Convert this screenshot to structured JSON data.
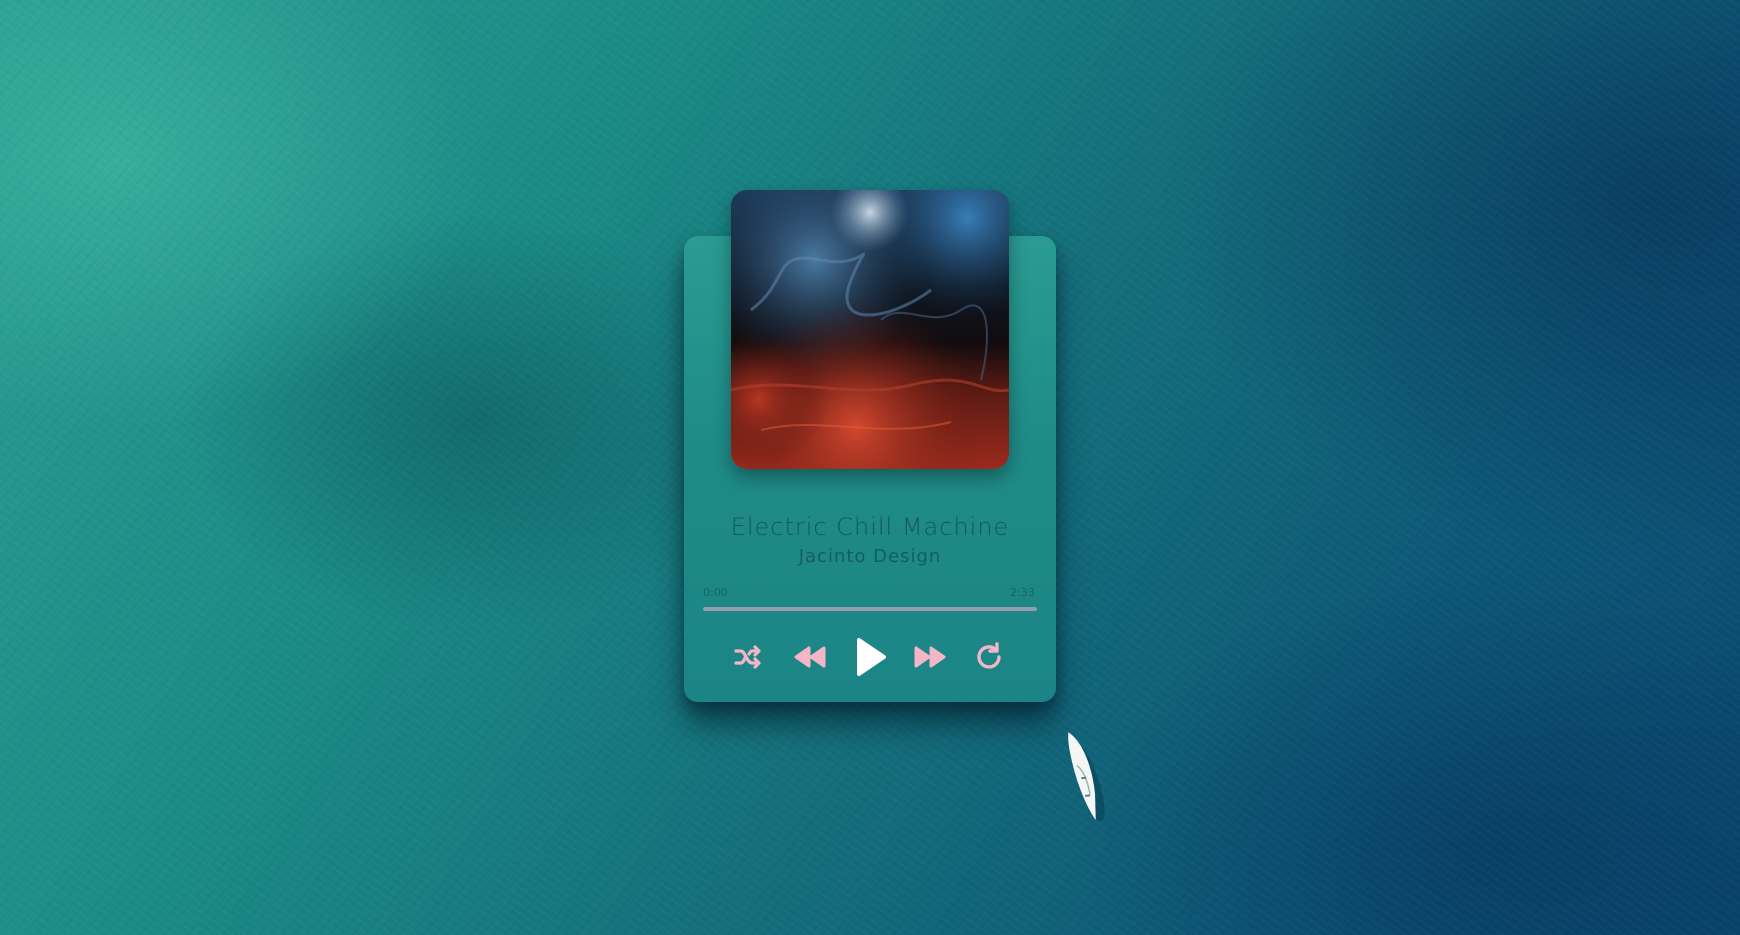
{
  "player": {
    "title": "Electric Chill Machine",
    "artist": "Jacinto Design",
    "time_current": "0:00",
    "time_total": "2:33",
    "progress_fraction": 0.0,
    "controls": {
      "shuffle_icon": "shuffle-icon",
      "prev_icon": "rewind-icon",
      "play_icon": "play-icon",
      "next_icon": "fast-forward-icon",
      "repeat_icon": "repeat-icon"
    },
    "colors": {
      "control_accent": "#f2b6c6",
      "play_button": "#ffffff",
      "progress_track": "#aaa0b9",
      "text": "#124648"
    }
  }
}
